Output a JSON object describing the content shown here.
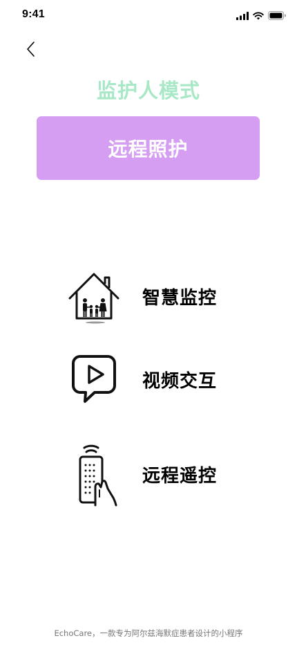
{
  "status_bar": {
    "time": "9:41",
    "signal_icon": "cellular-signal-icon",
    "wifi_icon": "wifi-icon",
    "battery_icon": "battery-icon"
  },
  "nav": {
    "back_icon": "chevron-left-icon"
  },
  "page": {
    "title": "监护人模式",
    "title_color": "#a8e8c6"
  },
  "primary_button": {
    "label": "远程照护",
    "color": "#d59ef2"
  },
  "features": [
    {
      "label": "智慧监控",
      "icon": "house-family-icon"
    },
    {
      "label": "视频交互",
      "icon": "video-play-chat-icon"
    },
    {
      "label": "远程遥控",
      "icon": "remote-control-icon"
    }
  ],
  "footer": {
    "text": "EchoCare，一款专为阿尔兹海默症患者设计的小程序"
  }
}
